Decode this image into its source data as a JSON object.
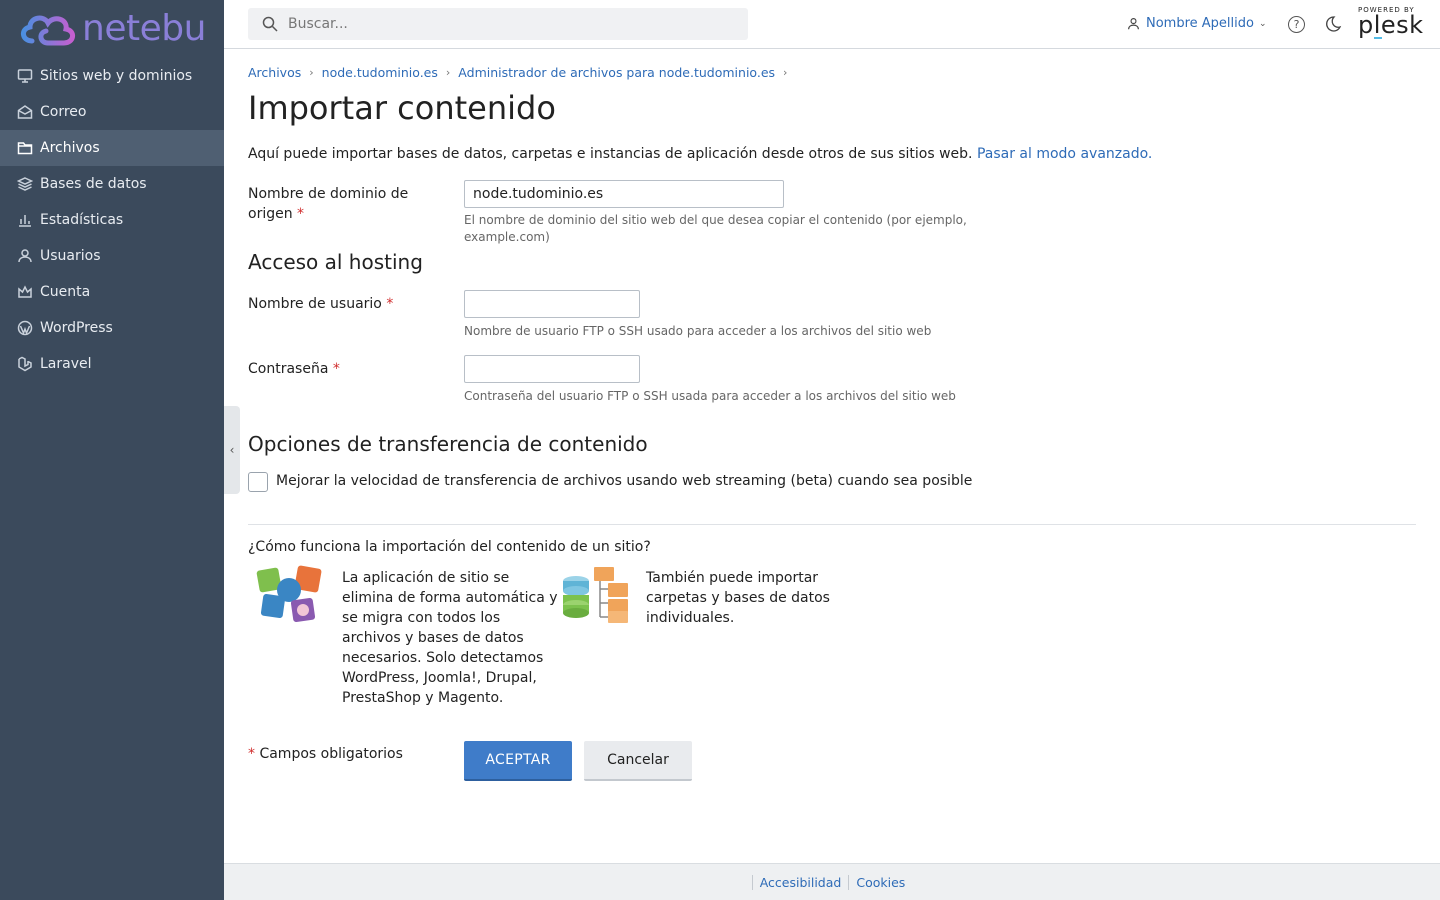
{
  "brand": {
    "logo_text": "netebu"
  },
  "sidebar": {
    "items": [
      {
        "label": "Sitios web y dominios",
        "icon": "monitor-icon"
      },
      {
        "label": "Correo",
        "icon": "mail-icon"
      },
      {
        "label": "Archivos",
        "icon": "folder-icon",
        "active": true
      },
      {
        "label": "Bases de datos",
        "icon": "database-icon"
      },
      {
        "label": "Estadísticas",
        "icon": "bar-chart-icon"
      },
      {
        "label": "Usuarios",
        "icon": "user-icon"
      },
      {
        "label": "Cuenta",
        "icon": "crown-icon"
      },
      {
        "label": "WordPress",
        "icon": "wordpress-icon"
      },
      {
        "label": "Laravel",
        "icon": "laravel-icon"
      }
    ]
  },
  "header": {
    "search_placeholder": "Buscar...",
    "user_name": "Nombre Apellido",
    "powered_by": "POWERED BY",
    "plesk": "plesk"
  },
  "breadcrumb": [
    "Archivos",
    "node.tudominio.es",
    "Administrador de archivos para node.tudominio.es"
  ],
  "page": {
    "title": "Importar contenido",
    "intro": "Aquí puede importar bases de datos, carpetas e instancias de aplicación desde otros de sus sitios web.",
    "intro_link": "Pasar al modo avanzado."
  },
  "form": {
    "source_domain": {
      "label_line1": "Nombre de dominio de",
      "label_line2": "origen",
      "value": "node.tudominio.es",
      "hint_line1": "El nombre de dominio del sitio web del que desea copiar el contenido (por ejemplo,",
      "hint_line2": "example.com)"
    },
    "hosting_section": "Acceso al hosting",
    "username": {
      "label": "Nombre de usuario",
      "value": "",
      "hint": "Nombre de usuario FTP o SSH usado para acceder a los archivos del sitio web"
    },
    "password": {
      "label": "Contraseña",
      "value": "",
      "hint": "Contraseña del usuario FTP o SSH usada para acceder a los archivos del sitio web"
    },
    "transfer_section": "Opciones de transferencia de contenido",
    "streaming_checkbox": {
      "label": "Mejorar la velocidad de transferencia de archivos usando web streaming (beta) cuando sea posible",
      "checked": false
    },
    "required_marker": "*"
  },
  "how": {
    "title": "¿Cómo funciona la importación del contenido de un sitio?",
    "app_text": [
      "La aplicación de sitio se",
      "elimina de forma automática y",
      "se migra con todos los",
      "archivos y bases de datos",
      "necesarios. Solo detectamos",
      "WordPress, Joomla!, Drupal,",
      "PrestaShop y Magento."
    ],
    "files_text": [
      "También puede importar",
      "carpetas y bases de datos",
      "individuales."
    ]
  },
  "actions": {
    "required_note": "Campos obligatorios",
    "ok": "ACEPTAR",
    "cancel": "Cancelar"
  },
  "footer": {
    "links": [
      "Accesibilidad",
      "Cookies"
    ]
  },
  "colors": {
    "sidebar": "#3b4a5c",
    "sidebar_active": "#4f5f72",
    "link": "#2e6bb7",
    "primary": "#3f7cc9",
    "required": "#d02d2d"
  }
}
